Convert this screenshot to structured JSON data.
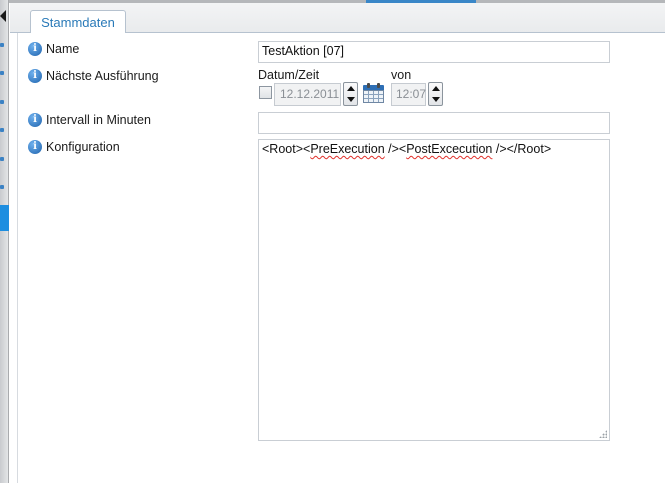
{
  "tab": {
    "label": "Stammdaten"
  },
  "fields": {
    "name": {
      "label": "Name",
      "value": "TestAktion [07]"
    },
    "next_run": {
      "label": "Nächste Ausführung",
      "date_label": "Datum/Zeit",
      "time_label": "von",
      "date_value": "12.12.2011",
      "time_value": "12:07",
      "enabled": false
    },
    "interval": {
      "label": "Intervall in Minuten",
      "value": ""
    },
    "config": {
      "label": "Konfiguration",
      "xml_parts": [
        "<Root><",
        "PreExecution",
        " /><",
        "PostExcecution",
        " /></Root>"
      ]
    }
  },
  "icons": {
    "info": "info-icon",
    "calendar": "calendar-icon",
    "collapse": "collapse-left-icon"
  },
  "colors": {
    "accent": "#2a7ab8",
    "selection": "#1d8ee0",
    "info_icon": "#1f63ad",
    "spellcheck": "#e0302a"
  }
}
